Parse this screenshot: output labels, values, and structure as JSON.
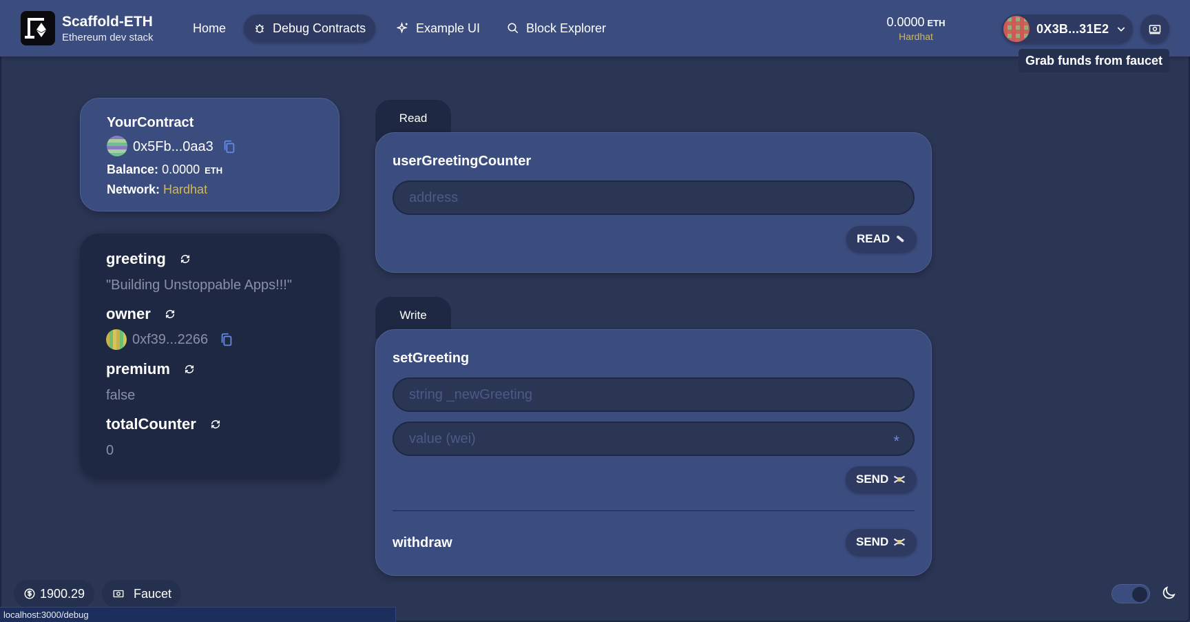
{
  "header": {
    "app_title": "Scaffold-ETH",
    "app_subtitle": "Ethereum dev stack",
    "nav": {
      "home": "Home",
      "debug": "Debug Contracts",
      "example": "Example UI",
      "explorer": "Block Explorer"
    },
    "balance": "0.0000",
    "balance_unit": "ETH",
    "network": "Hardhat",
    "account": "0X3B...31E2",
    "faucet_tooltip": "Grab funds from faucet"
  },
  "contract": {
    "name": "YourContract",
    "address": "0x5Fb...0aa3",
    "balance_label": "Balance:",
    "balance": "0.0000",
    "balance_unit": "ETH",
    "network_label": "Network:",
    "network": "Hardhat"
  },
  "variables": {
    "greeting_name": "greeting",
    "greeting_value": "\"Building Unstoppable Apps!!!\"",
    "owner_name": "owner",
    "owner_value": "0xf39...2266",
    "premium_name": "premium",
    "premium_value": "false",
    "total_name": "totalCounter",
    "total_value": "0"
  },
  "read": {
    "tab": "Read",
    "fn_name": "userGreetingCounter",
    "input_placeholder": "address",
    "button": "READ"
  },
  "write": {
    "tab": "Write",
    "fn1_name": "setGreeting",
    "fn1_input1_placeholder": "string _newGreeting",
    "fn1_input2_placeholder": "value (wei)",
    "fn1_input2_suffix": "*",
    "fn1_button": "SEND",
    "fn2_name": "withdraw",
    "fn2_button": "SEND"
  },
  "footer": {
    "price": "1900.29",
    "faucet": "Faucet",
    "status_url": "localhost:3000/debug"
  },
  "colors": {
    "background": "#2b3655",
    "header": "#3b4c7e",
    "card": "#3b4c7e",
    "card_dark": "#1f2842",
    "network_accent": "#d7b94a"
  }
}
